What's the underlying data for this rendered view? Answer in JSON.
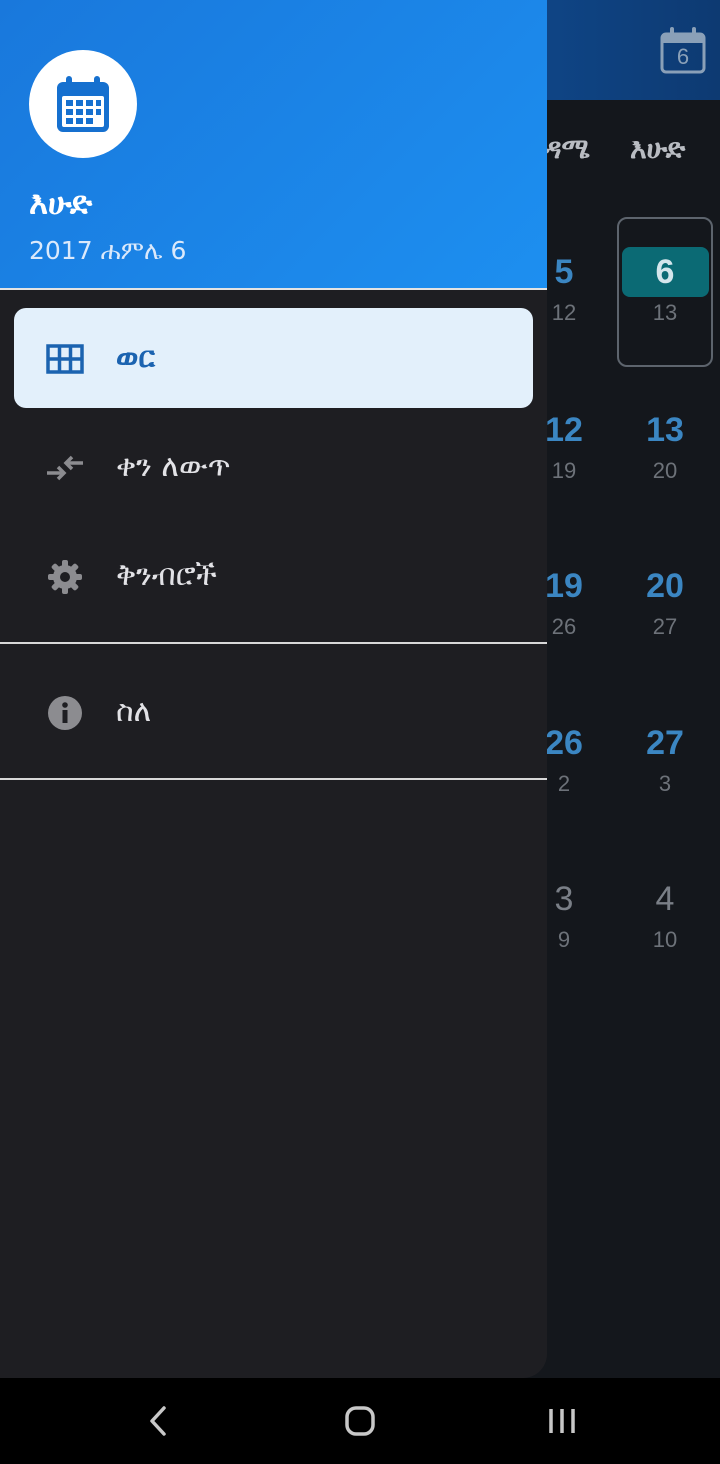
{
  "background": {
    "today_badge": "6",
    "weekdays": [
      "ዳሜ",
      "እሁድ"
    ],
    "weeks": [
      {
        "a": {
          "num": "5",
          "sub": "12"
        },
        "b": {
          "num": "6",
          "sub": "13"
        }
      },
      {
        "a": {
          "num": "12",
          "sub": "19"
        },
        "b": {
          "num": "13",
          "sub": "20"
        }
      },
      {
        "a": {
          "num": "19",
          "sub": "26"
        },
        "b": {
          "num": "20",
          "sub": "27"
        }
      },
      {
        "a": {
          "num": "26",
          "sub": "2"
        },
        "b": {
          "num": "27",
          "sub": "3"
        }
      },
      {
        "a": {
          "num": "3",
          "sub": "9"
        },
        "b": {
          "num": "4",
          "sub": "10"
        }
      }
    ]
  },
  "drawer": {
    "header": {
      "avatar_icon": "calendar-icon",
      "day_name": "እሁድ",
      "date": "2017 ሐምሌ 6"
    },
    "items": [
      {
        "label": "ወር",
        "icon": "grid-icon",
        "active": true
      },
      {
        "label": "ቀን ለውጥ",
        "icon": "convert-arrows-icon",
        "active": false
      },
      {
        "label": "ቅንብሮች",
        "icon": "gear-icon",
        "active": false
      },
      {
        "label": "ስለ",
        "icon": "info-icon",
        "active": false
      }
    ]
  },
  "colors": {
    "header": "#1e88e5",
    "active_item_bg": "#e3f0fb",
    "active_item_fg": "#1b63b0",
    "today_pill": "#0b6a74"
  },
  "navbar": {
    "icons": [
      "back-icon",
      "home-icon",
      "recents-icon"
    ]
  }
}
